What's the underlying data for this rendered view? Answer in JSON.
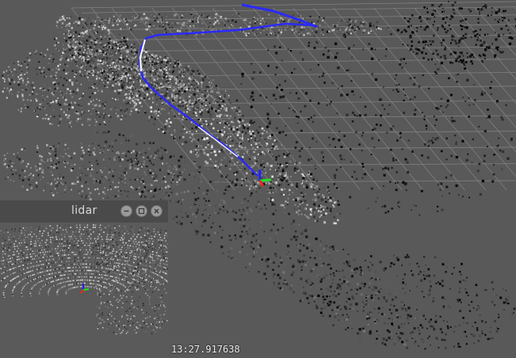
{
  "lidar_window": {
    "title": "lidar",
    "controls": {
      "minimize": "minimize-icon",
      "maximize": "maximize-icon",
      "close": "close-icon"
    }
  },
  "overlay": {
    "timestamp": "13:27.917638"
  },
  "colors": {
    "background": "#595959",
    "grid": "#8a8a8a",
    "trajectory_blue": "#2a2aff",
    "trajectory_white": "#ffffff",
    "axis_x": "#ff2020",
    "axis_y": "#20e020",
    "axis_z": "#2020ff",
    "window_titlebar": "#4a4a4a"
  }
}
